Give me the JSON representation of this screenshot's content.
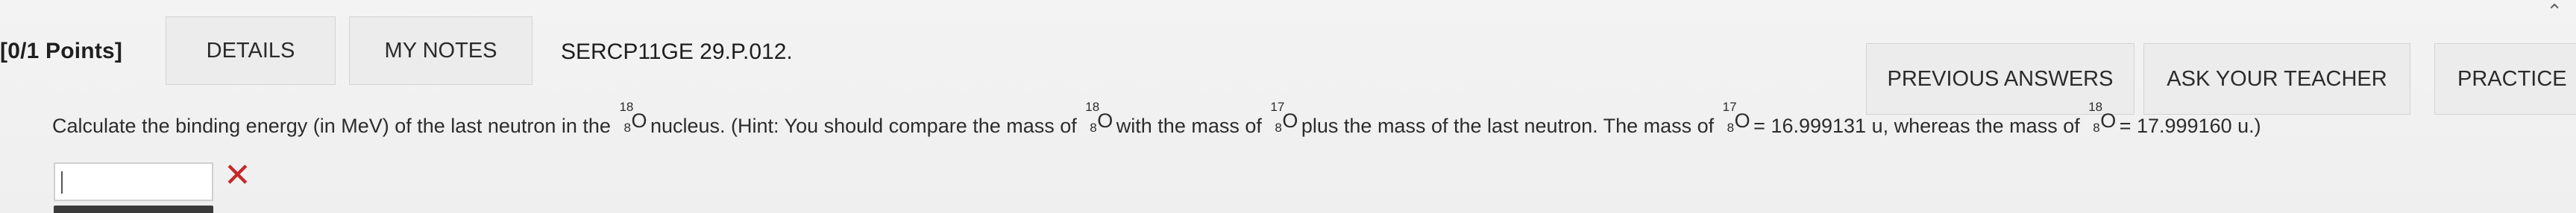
{
  "header": {
    "points": "[0/1 Points]",
    "tabs": {
      "details": "DETAILS",
      "my_notes": "MY NOTES"
    },
    "problem_id": "SERCP11GE 29.P.012.",
    "actions": {
      "previous_answers": "PREVIOUS ANSWERS",
      "ask_teacher": "ASK YOUR TEACHER",
      "practice": "PRACTICE"
    }
  },
  "problem": {
    "seg1": "Calculate the binding energy (in MeV) of the last neutron in the ",
    "nuc1": {
      "mass": "18",
      "num": "8",
      "sym": "O"
    },
    "seg2": " nucleus. (Hint: You should compare the mass of ",
    "nuc2": {
      "mass": "18",
      "num": "8",
      "sym": "O"
    },
    "seg3": " with the mass of ",
    "nuc3": {
      "mass": "17",
      "num": "8",
      "sym": "O"
    },
    "seg4": " plus the mass of the last neutron. The mass of ",
    "nuc4": {
      "mass": "17",
      "num": "8",
      "sym": "O"
    },
    "seg5": " = 16.999131 u, whereas the mass of ",
    "nuc5": {
      "mass": "18",
      "num": "8",
      "sym": "O"
    },
    "seg6": " = 17.999160 u.)"
  },
  "answer": {
    "value": "",
    "status_icon": "x-icon",
    "status_color": "#c62828"
  }
}
